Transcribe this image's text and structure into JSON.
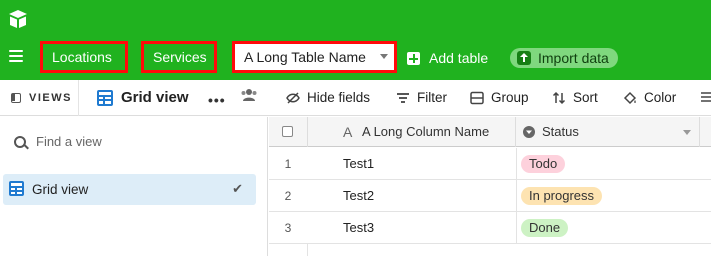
{
  "topbar": {
    "tabs": [
      {
        "label": "Locations"
      },
      {
        "label": "Services"
      },
      {
        "label": "A Long Table Name"
      }
    ],
    "add_table": "Add table",
    "import_data": "Import data"
  },
  "toolbar": {
    "views": "VIEWS",
    "view_title": "Grid view",
    "more": "•••",
    "hide_fields": "Hide fields",
    "filter": "Filter",
    "group": "Group",
    "sort": "Sort",
    "color": "Color"
  },
  "sidebar": {
    "find_placeholder": "Find a view",
    "items": [
      {
        "label": "Grid view",
        "check": "✔"
      }
    ]
  },
  "grid": {
    "columns": [
      "A Long Column Name",
      "Status"
    ],
    "rows": [
      {
        "num": "1",
        "name": "Test1",
        "status": "Todo",
        "status_color": "#fdd1dc"
      },
      {
        "num": "2",
        "name": "Test2",
        "status": "In progress",
        "status_color": "#fde3b1"
      },
      {
        "num": "3",
        "name": "Test3",
        "status": "Done",
        "status_color": "#cdf2c4"
      }
    ]
  },
  "colors": {
    "brand_green": "#20b21f",
    "highlight_red": "#ff0a0a",
    "accent_blue": "#1f7ad0"
  }
}
